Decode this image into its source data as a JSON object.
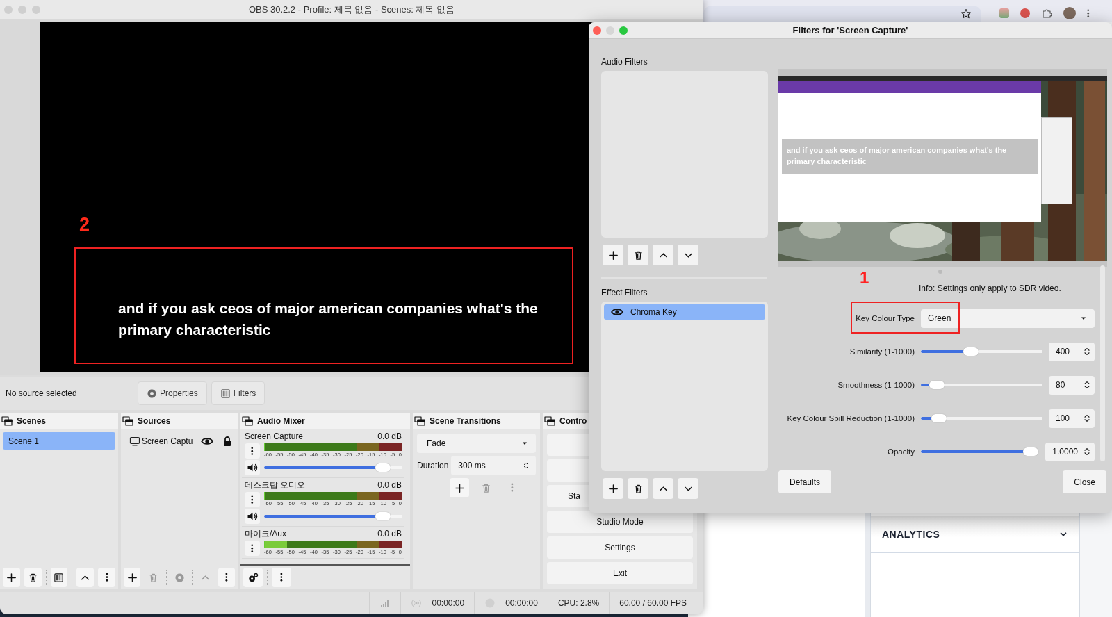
{
  "obs_window": {
    "title": "OBS 30.2.2 - Profile: 제목 없음 - Scenes: 제목 없음"
  },
  "preview": {
    "annotation": "2",
    "boxed": true,
    "caption": "and if you ask ceos of major american companies what's the primary characteristic"
  },
  "source_bar": {
    "status": "No source selected",
    "buttons": [
      "Properties",
      "Filters"
    ]
  },
  "scenes": {
    "title": "Scenes",
    "items": [
      {
        "label": "Scene 1",
        "selected": true
      }
    ],
    "toolbar": [
      {
        "disabled": false
      },
      {
        "disabled": false
      },
      {
        "disabled": false
      },
      {
        "disabled": false
      },
      {
        "disabled": false
      }
    ]
  },
  "sources": {
    "title": "Sources",
    "items": [
      {
        "label": "Screen Captu",
        "visible": true,
        "locked": true
      }
    ],
    "toolbar": [
      {
        "disabled": false
      },
      {
        "disabled": true
      },
      {
        "disabled": true
      },
      {
        "disabled": true
      },
      {
        "disabled": false
      }
    ]
  },
  "audio_mixer": {
    "title": "Audio Mixer",
    "channels": [
      {
        "name": "Screen Capture",
        "reading": "0.0 dB",
        "scale": [
          "-60",
          "-55",
          "-50",
          "-45",
          "-40",
          "-35",
          "-30",
          "-25",
          "-20",
          "-15",
          "-10",
          "-5",
          "0"
        ],
        "volume": {
          "level": 0.91
        }
      },
      {
        "name": "데스크탑 오디오",
        "reading": "0.0 dB",
        "scale": [
          "-60",
          "-55",
          "-50",
          "-45",
          "-40",
          "-35",
          "-30",
          "-25",
          "-20",
          "-15",
          "-10",
          "-5",
          "0"
        ],
        "volume": {
          "level": 0.91
        }
      },
      {
        "name": "마이크/Aux",
        "reading": "0.0 dB",
        "meter": {
          "level": 0.16
        },
        "scale": [
          "-60",
          "-55",
          "-50",
          "-45",
          "-40",
          "-35",
          "-30",
          "-25",
          "-20",
          "-15",
          "-10",
          "-5",
          "0"
        ]
      }
    ],
    "toolbar": [
      {
        "disabled": false
      },
      {
        "disabled": false
      }
    ]
  },
  "scene_transitions": {
    "title": "Scene Transitions",
    "transition": "Fade",
    "duration_label": "Duration",
    "duration": "300 ms",
    "toolbar": [
      {
        "disabled": false
      },
      {
        "disabled": true
      },
      {
        "disabled": true
      }
    ]
  },
  "controls": {
    "title": "Contro",
    "buttons": [
      {
        "kind": "covered"
      },
      {
        "kind": "covered"
      },
      {
        "kind": "cut",
        "label": "Sta"
      },
      {
        "kind": "full",
        "label": "Studio Mode"
      },
      {
        "kind": "full",
        "label": "Settings"
      },
      {
        "kind": "full",
        "label": "Exit"
      }
    ]
  },
  "status_bar": {
    "stream_time": "00:00:00",
    "record_time": "00:00:00",
    "cpu": "CPU: 2.8%",
    "fps": "60.00 / 60.00 FPS"
  },
  "filters_dialog": {
    "title": "Filters for 'Screen Capture'",
    "audio_filters": {
      "label": "Audio Filters"
    },
    "effect_filters": {
      "label": "Effect Filters",
      "items": [
        {
          "label": "Chroma Key",
          "visible": true,
          "selected": true
        }
      ]
    },
    "preview": {
      "kind": "picture",
      "caption": "and if you ask ceos of major american companies what's the primary characteristic"
    },
    "annotation": "1",
    "info": "Info: Settings only apply to SDR video.",
    "fields": [
      {
        "kind": "combo",
        "label": "Key Colour Type",
        "value": "Green",
        "boxed": true
      },
      {
        "kind": "slider",
        "label": "Similarity (1-1000)",
        "level": 0.4,
        "value": "400"
      },
      {
        "kind": "slider",
        "label": "Smoothness (1-1000)",
        "level": 0.08,
        "value": "80"
      },
      {
        "kind": "slider",
        "label": "Key Colour Spill Reduction (1-1000)",
        "level": 0.1,
        "value": "100"
      },
      {
        "kind": "slider",
        "label": "Opacity",
        "level": 1,
        "value": "1.0000"
      }
    ],
    "buttons": [
      "Defaults",
      "Close"
    ]
  },
  "browser": {
    "section": "ANALYTICS"
  }
}
